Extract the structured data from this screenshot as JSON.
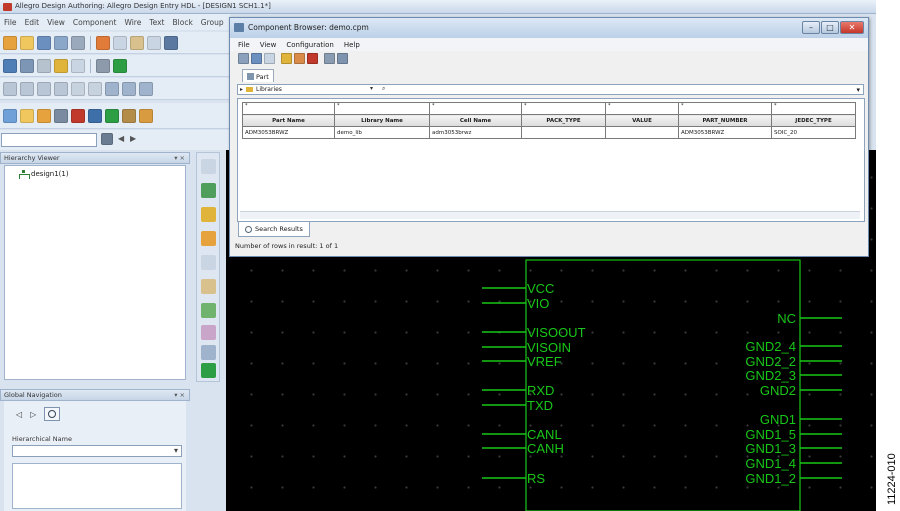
{
  "app": {
    "title": "Allegro Design Authoring: Allegro Design Entry HDL - [DESIGN1 SCH1.1*]",
    "menu": [
      "File",
      "Edit",
      "View",
      "Component",
      "Wire",
      "Text",
      "Block",
      "Group"
    ]
  },
  "hierarchy_viewer": {
    "title": "Hierarchy Viewer",
    "root": "design1(1)"
  },
  "global_navigation": {
    "title": "Global Navigation",
    "hierarchical_name_label": "Hierarchical Name"
  },
  "component_browser": {
    "title": "Component Browser: demo.cpm",
    "menu": [
      "File",
      "View",
      "Configuration",
      "Help"
    ],
    "find_tab": "Part",
    "library_combo": "Libraries",
    "columns": [
      "Part Name",
      "Library Name",
      "Cell Name",
      "PACK_TYPE",
      "VALUE",
      "PART_NUMBER",
      "JEDEC_TYPE"
    ],
    "filters": [
      "*",
      "*",
      "*",
      "*",
      "*",
      "*",
      "*"
    ],
    "rows": [
      [
        "ADM3053BRWZ",
        "demo_lib",
        "adm3053brwz",
        "",
        "",
        "ADM3053BRWZ",
        "SOIC_20"
      ]
    ],
    "results_tab": "Search Results",
    "status": "Number of rows in result: 1 of 1"
  },
  "schematic": {
    "left_pins": [
      "VCC",
      "VIO",
      "VISOOUT",
      "VISOIN",
      "VREF",
      "RXD",
      "TXD",
      "CANL",
      "CANH",
      "RS"
    ],
    "right_pins": [
      "NC",
      "GND2_4",
      "GND2_2",
      "GND2_3",
      "GND2",
      "GND1",
      "GND1_5",
      "GND1_3",
      "GND1_4",
      "GND1_2"
    ],
    "color": "#19c719"
  },
  "figure_id": "11224-010"
}
